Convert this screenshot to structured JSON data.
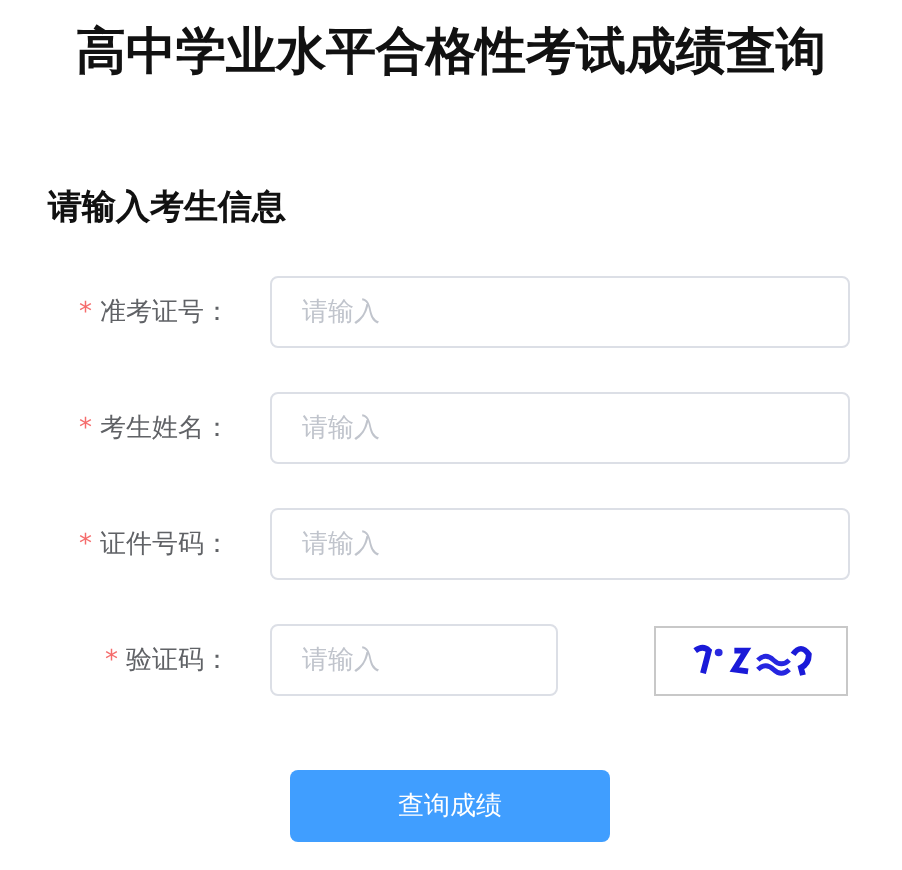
{
  "page_title": "高中学业水平合格性考试成绩查询",
  "section_title": "请输入考生信息",
  "fields": [
    {
      "kind": "text",
      "required_mark": "*",
      "label": "准考证号：",
      "placeholder": "请输入"
    },
    {
      "kind": "text",
      "required_mark": "*",
      "label": "考生姓名：",
      "placeholder": "请输入"
    },
    {
      "kind": "text",
      "required_mark": "*",
      "label": "证件号码：",
      "placeholder": "请输入"
    },
    {
      "kind": "captcha",
      "required_mark": "*",
      "label": "验证码：",
      "placeholder": "请输入"
    }
  ],
  "submit_button": "查询成绩"
}
